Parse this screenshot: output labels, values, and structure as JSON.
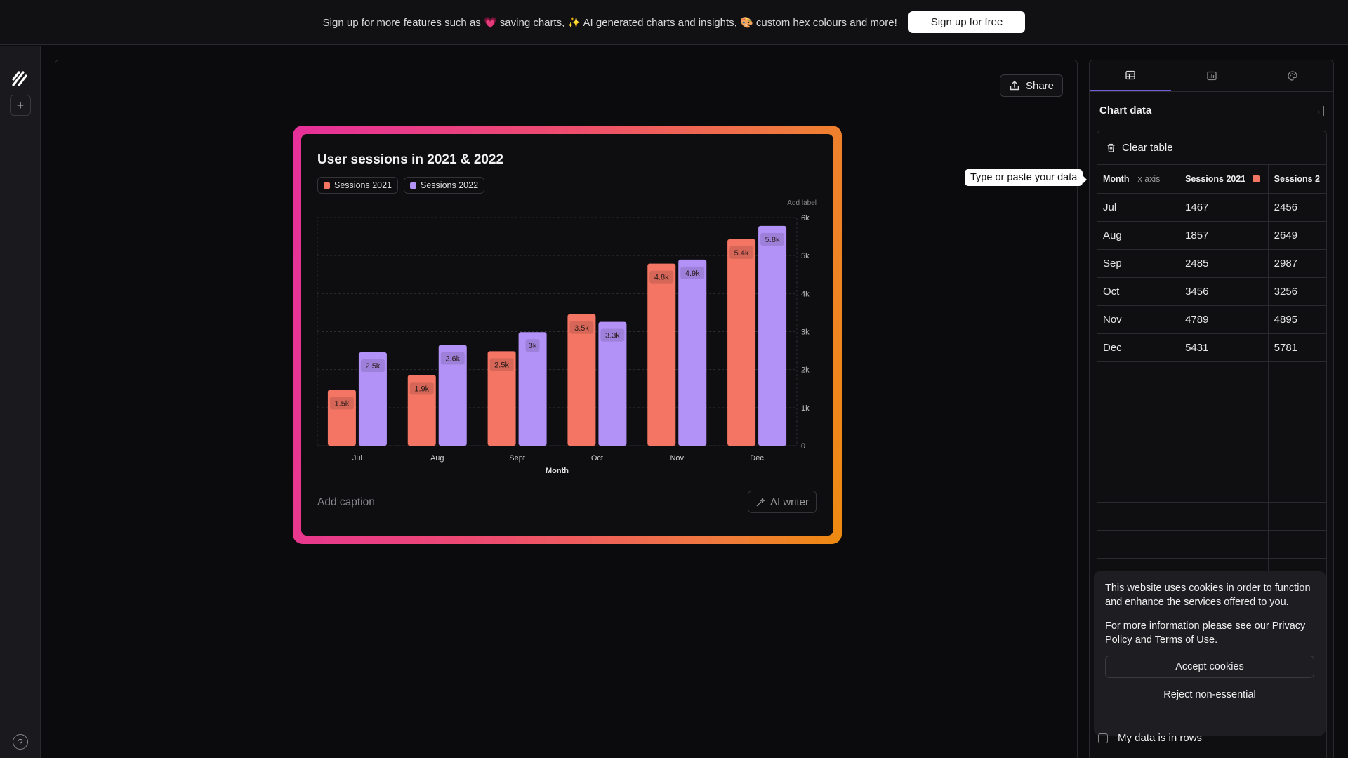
{
  "banner": {
    "text": "Sign up for more features such as 💗 saving charts, ✨ AI generated charts and insights, 🎨 custom hex colours and more!",
    "button": "Sign up for free"
  },
  "canvas": {
    "share_label": "Share",
    "caption_placeholder": "Add caption",
    "ai_writer_label": "AI writer",
    "add_label": "Add label"
  },
  "chart_data": {
    "type": "bar",
    "title": "User sessions in 2021 & 2022",
    "xlabel": "Month",
    "ylabel": "",
    "categories": [
      "Jul",
      "Aug",
      "Sept",
      "Oct",
      "Nov",
      "Dec"
    ],
    "series": [
      {
        "name": "Sessions 2021",
        "color": "#f47563",
        "values": [
          1467,
          1857,
          2485,
          3456,
          4789,
          5431
        ],
        "labels": [
          "1.5k",
          "1.9k",
          "2.5k",
          "3.5k",
          "4.8k",
          "5.4k"
        ]
      },
      {
        "name": "Sessions 2022",
        "color": "#b392f7",
        "values": [
          2456,
          2649,
          2987,
          3256,
          4895,
          5781
        ],
        "labels": [
          "2.5k",
          "2.6k",
          "3k",
          "3.3k",
          "4.9k",
          "5.8k"
        ]
      }
    ],
    "ylim": [
      0,
      6000
    ],
    "yticks": [
      0,
      1000,
      2000,
      3000,
      4000,
      5000,
      6000
    ],
    "ytick_labels": [
      "0",
      "1k",
      "2k",
      "3k",
      "4k",
      "5k",
      "6k"
    ],
    "grid": true,
    "legend": "top-left"
  },
  "tooltip": "Type or paste your data",
  "panel": {
    "title": "Chart data",
    "clear_label": "Clear table",
    "columns": [
      {
        "label": "Month",
        "sub": "x axis"
      },
      {
        "label": "Sessions 2021",
        "color": "#f47563"
      },
      {
        "label": "Sessions 2"
      }
    ],
    "rows": [
      [
        "Jul",
        "1467",
        "2456"
      ],
      [
        "Aug",
        "1857",
        "2649"
      ],
      [
        "Sep",
        "2485",
        "2987"
      ],
      [
        "Oct",
        "3456",
        "3256"
      ],
      [
        "Nov",
        "4789",
        "4895"
      ],
      [
        "Dec",
        "5431",
        "5781"
      ]
    ],
    "empty_rows": 8,
    "rows_toggle_label": "My data is in rows"
  },
  "cookie": {
    "text": "This website uses cookies in order to function and enhance the services offered to you.",
    "more_prefix": "For more information please see our ",
    "privacy": "Privacy Policy",
    "and": " and ",
    "terms": "Terms of Use",
    "suffix": ".",
    "accept": "Accept cookies",
    "reject": "Reject non-essential"
  }
}
